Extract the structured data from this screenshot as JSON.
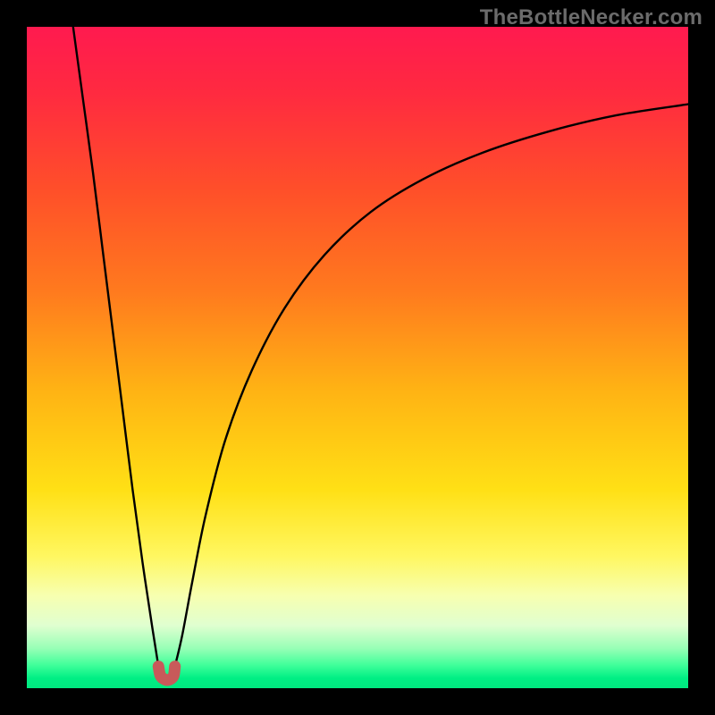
{
  "watermark": "TheBottleNecker.com",
  "chart_data": {
    "type": "line",
    "title": "",
    "xlabel": "",
    "ylabel": "",
    "xlim": [
      0,
      100
    ],
    "ylim": [
      0,
      100
    ],
    "gradient_stops": [
      {
        "offset": 0.0,
        "color": "#ff1a4f"
      },
      {
        "offset": 0.1,
        "color": "#ff2a40"
      },
      {
        "offset": 0.25,
        "color": "#ff5029"
      },
      {
        "offset": 0.4,
        "color": "#ff7a1e"
      },
      {
        "offset": 0.55,
        "color": "#ffb314"
      },
      {
        "offset": 0.7,
        "color": "#ffe015"
      },
      {
        "offset": 0.8,
        "color": "#fff760"
      },
      {
        "offset": 0.86,
        "color": "#f7ffb0"
      },
      {
        "offset": 0.905,
        "color": "#e0ffd0"
      },
      {
        "offset": 0.94,
        "color": "#97ffb6"
      },
      {
        "offset": 0.965,
        "color": "#40ff9a"
      },
      {
        "offset": 0.985,
        "color": "#00ef84"
      },
      {
        "offset": 1.0,
        "color": "#00e87f"
      }
    ],
    "series": [
      {
        "name": "left-branch",
        "x": [
          7.0,
          8.5,
          10.0,
          11.5,
          13.0,
          14.5,
          16.0,
          17.5,
          19.0,
          19.9
        ],
        "y": [
          100.0,
          89.0,
          78.0,
          66.0,
          54.0,
          42.0,
          30.0,
          19.0,
          9.0,
          3.3
        ]
      },
      {
        "name": "right-branch",
        "x": [
          22.4,
          23.5,
          25.0,
          27.0,
          30.0,
          34.0,
          39.0,
          45.0,
          52.0,
          60.0,
          69.0,
          79.0,
          89.0,
          100.0
        ],
        "y": [
          3.3,
          8.0,
          16.0,
          26.0,
          37.5,
          48.0,
          57.5,
          65.5,
          72.0,
          77.0,
          81.0,
          84.2,
          86.6,
          88.3
        ]
      }
    ],
    "marker": {
      "name": "u-marker",
      "color": "#c85a5a",
      "points": [
        {
          "x": 19.9,
          "y": 3.3
        },
        {
          "x": 20.2,
          "y": 1.9
        },
        {
          "x": 20.9,
          "y": 1.3
        },
        {
          "x": 21.6,
          "y": 1.3
        },
        {
          "x": 22.2,
          "y": 1.9
        },
        {
          "x": 22.4,
          "y": 3.3
        }
      ]
    }
  }
}
